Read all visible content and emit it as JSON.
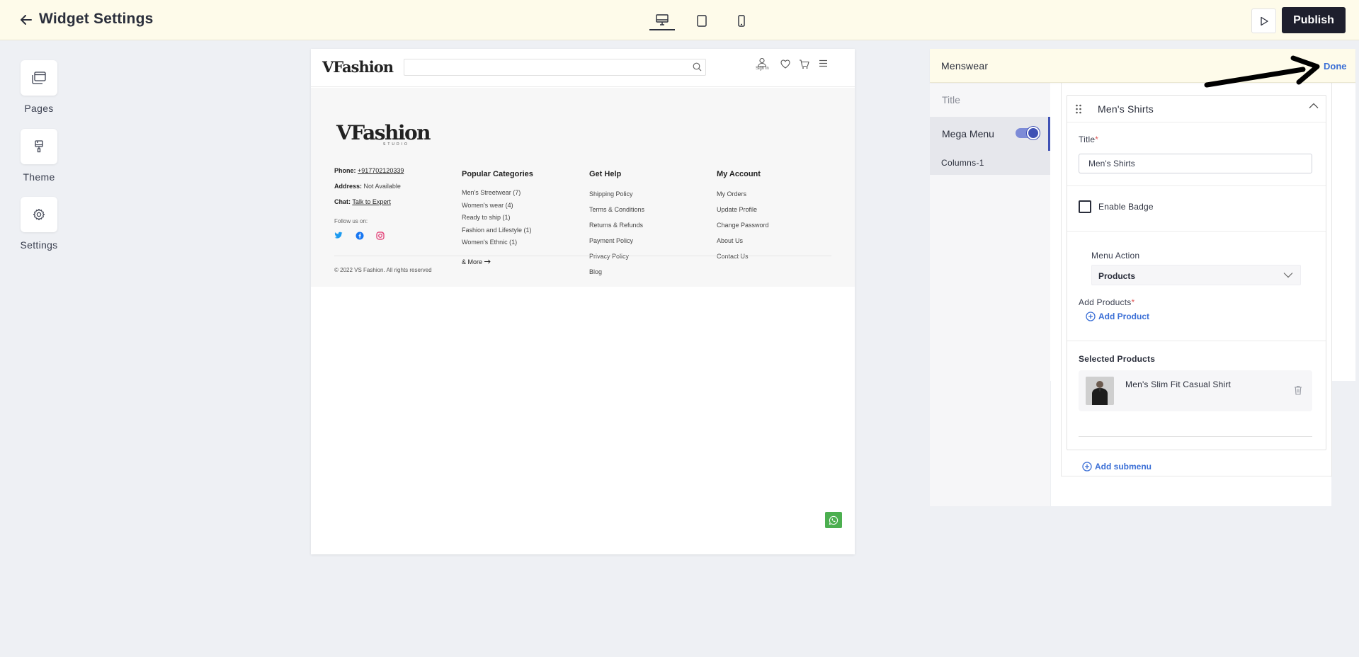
{
  "header": {
    "title": "Widget Settings",
    "publish_label": "Publish"
  },
  "rail": {
    "items": [
      {
        "label": "Pages",
        "icon": "pages-icon"
      },
      {
        "label": "Theme",
        "icon": "theme-brush-icon"
      },
      {
        "label": "Settings",
        "icon": "gear-icon"
      }
    ]
  },
  "site": {
    "logo": "VFashion",
    "logo_sub": "STUDIO",
    "sign_in": "Sign In",
    "contact": {
      "phone_label": "Phone:",
      "phone": "+917702120339",
      "address_label": "Address:",
      "address": "Not Available",
      "chat_label": "Chat:",
      "chat": "Talk to Expert"
    },
    "follow": "Follow us on:",
    "columns": [
      {
        "heading": "Popular Categories",
        "links": [
          "Men's Streetwear (7)",
          "Women's wear (4)",
          "Ready to ship (1)",
          "Fashion and Lifestyle (1)",
          "Women's Ethnic (1)"
        ]
      },
      {
        "heading": "Get Help",
        "links": [
          "Shipping Policy",
          "Terms & Conditions",
          "Returns & Refunds",
          "Payment Policy",
          "Privacy Policy",
          "Blog"
        ]
      },
      {
        "heading": "My Account",
        "links": [
          "My Orders",
          "Update Profile",
          "Change Password",
          "About Us",
          "Contact Us"
        ]
      }
    ],
    "more": "& More",
    "copyright": "© 2022 VS Fashion. All rights reserved"
  },
  "panel": {
    "title": "Menswear",
    "done_label": "Done",
    "nav": {
      "title": "Title",
      "mega_menu": "Mega Menu",
      "mega_menu_enabled": true,
      "columns": "Columns-1"
    },
    "submenu": {
      "title": "Men's Shirts",
      "title_label": "Title",
      "title_value": "Men's Shirts",
      "enable_badge": "Enable Badge",
      "enable_badge_checked": false,
      "menu_action_label": "Menu Action",
      "menu_action_value": "Products",
      "add_products_label": "Add Products",
      "add_product": "Add Product",
      "selected_products_label": "Selected Products",
      "products": [
        "Men's Slim Fit Casual Shirt"
      ]
    },
    "add_submenu": "Add submenu"
  },
  "colors": {
    "accent": "#3f51b5",
    "link": "#3b6fd6",
    "topbar_bg": "#fefbea",
    "publish_bg": "#1e1f2d",
    "whatsapp": "#4caf50"
  }
}
